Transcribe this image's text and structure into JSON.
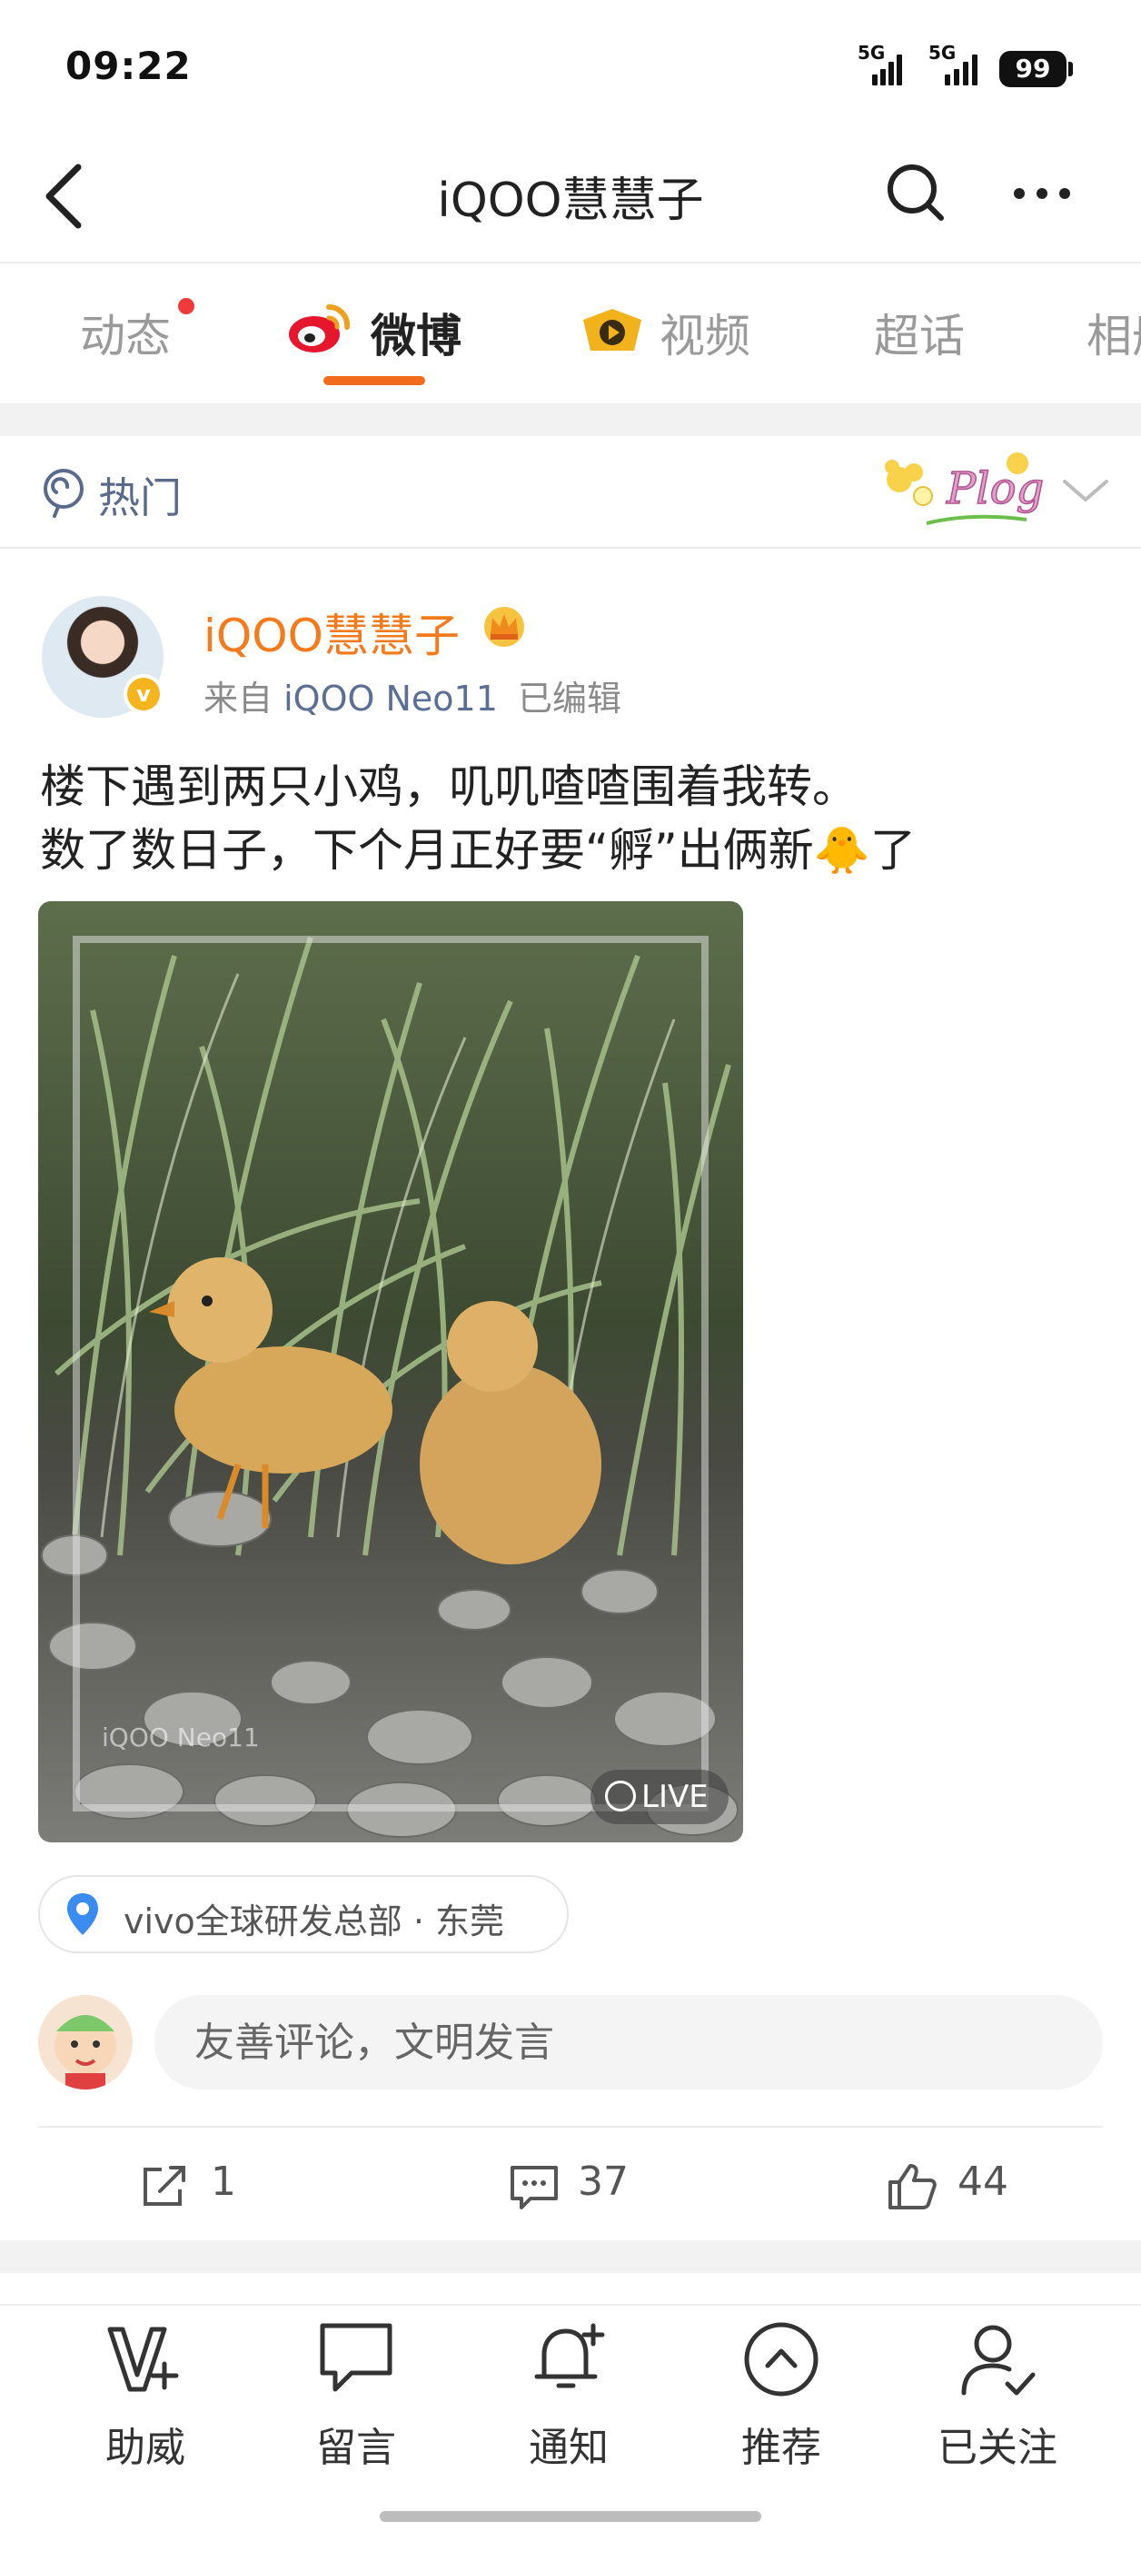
{
  "status_bar": {
    "time": "09:22",
    "network1": "5G",
    "network2": "5G",
    "battery": "99"
  },
  "header": {
    "title": "iQOO慧慧子"
  },
  "tabs": [
    {
      "label": "动态"
    },
    {
      "label": "微博"
    },
    {
      "label": "视频"
    },
    {
      "label": "超话"
    },
    {
      "label": "相册"
    }
  ],
  "filter": {
    "label": "热门",
    "sticker_text": "Plog"
  },
  "post": {
    "author": "iQOO慧慧子",
    "source_prefix": "来自",
    "source_device": "iQOO Neo11",
    "edited": "已编辑",
    "text_line1": "楼下遇到两只小鸡，叽叽喳喳围着我转。",
    "text_line2": "数了数日子，下个月正好要“孵”出俩新🐥了",
    "photo_watermark_title": "iQOO Neo11",
    "live_label": "LIVE",
    "location": "vivo全球研发总部 · 东莞"
  },
  "comment_box": {
    "placeholder": "友善评论，文明发言"
  },
  "actions": {
    "reposts": "1",
    "comments": "37",
    "likes": "44"
  },
  "bottom_nav": [
    {
      "label": "助威"
    },
    {
      "label": "留言"
    },
    {
      "label": "通知"
    },
    {
      "label": "推荐"
    },
    {
      "label": "已关注"
    }
  ],
  "colors": {
    "accent": "#f26b1d",
    "author": "#f37b1d",
    "notify_dot": "#f03a3a",
    "link_blue": "#5b6f94"
  }
}
